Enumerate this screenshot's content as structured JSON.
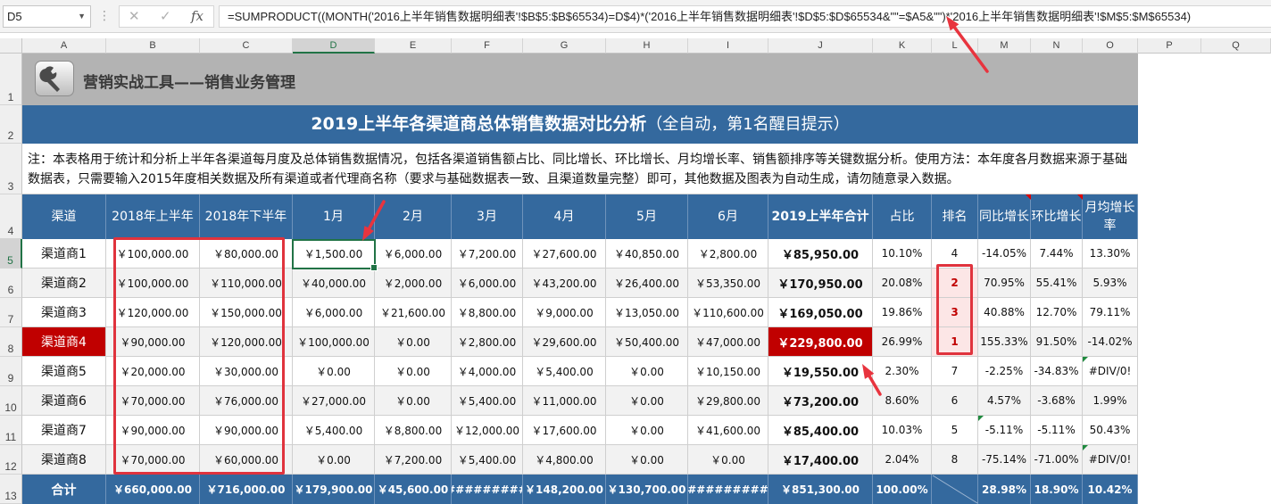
{
  "name_box": "D5",
  "formula": "=SUMPRODUCT((MONTH('2016上半年销售数据明细表'!$B$5:$B$65534)=D$4)*('2016上半年销售数据明细表'!$D$5:$D$65534&\"\"=$A5&\"\")*'2016上半年销售数据明细表'!$M$5:$M$65534)",
  "columns": [
    "A",
    "B",
    "C",
    "D",
    "E",
    "F",
    "G",
    "H",
    "I",
    "J",
    "K",
    "L",
    "M",
    "N",
    "O",
    "P",
    "Q"
  ],
  "rows": [
    "1",
    "2",
    "3",
    "4",
    "5",
    "6",
    "7",
    "8",
    "9",
    "10",
    "11",
    "12",
    "13"
  ],
  "app_title": "营销实战工具——销售业务管理",
  "sheet_title": "2019上半年各渠道商总体销售数据对比分析",
  "sheet_subtitle": "（全自动，第1名醒目提示）",
  "note": "注：本表格用于统计和分析上半年各渠道每月度及总体销售数据情况，包括各渠道销售额占比、同比增长、环比增长、月均增长率、销售额排序等关键数据分析。使用方法：本年度各月数据来源于基础数据表，只需要输入2015年度相关数据及所有渠道或者代理商名称（要求与基础数据表一致、且渠道数量完整）即可，其他数据及图表为自动生成，请勿随意录入数据。",
  "headers": [
    "渠道",
    "2018年上半年",
    "2018年下半年",
    "1月",
    "2月",
    "3月",
    "4月",
    "5月",
    "6月",
    "2019上半年合计",
    "占比",
    "排名",
    "同比增长",
    "环比增长",
    "月均增长率"
  ],
  "data_rows": [
    {
      "cells": [
        "渠道商1",
        "￥100,000.00",
        "￥80,000.00",
        "￥1,500.00",
        "￥6,000.00",
        "￥7,200.00",
        "￥27,600.00",
        "￥40,850.00",
        "￥2,800.00",
        "￥85,950.00",
        "10.10%",
        "4",
        "-14.05%",
        "7.44%",
        "13.30%"
      ]
    },
    {
      "cells": [
        "渠道商2",
        "￥100,000.00",
        "￥110,000.00",
        "￥40,000.00",
        "￥2,000.00",
        "￥6,000.00",
        "￥43,200.00",
        "￥26,400.00",
        "￥53,350.00",
        "￥170,950.00",
        "20.08%",
        "2",
        "70.95%",
        "55.41%",
        "5.93%"
      ]
    },
    {
      "cells": [
        "渠道商3",
        "￥120,000.00",
        "￥150,000.00",
        "￥6,000.00",
        "￥21,600.00",
        "￥8,800.00",
        "￥9,000.00",
        "￥13,050.00",
        "￥110,600.00",
        "￥169,050.00",
        "19.86%",
        "3",
        "40.88%",
        "12.70%",
        "79.11%"
      ]
    },
    {
      "cells": [
        "渠道商4",
        "￥90,000.00",
        "￥120,000.00",
        "￥100,000.00",
        "￥0.00",
        "￥2,800.00",
        "￥29,600.00",
        "￥50,400.00",
        "￥47,000.00",
        "￥229,800.00",
        "26.99%",
        "1",
        "155.33%",
        "91.50%",
        "-14.02%"
      ]
    },
    {
      "cells": [
        "渠道商5",
        "￥20,000.00",
        "￥30,000.00",
        "￥0.00",
        "￥0.00",
        "￥4,000.00",
        "￥5,400.00",
        "￥0.00",
        "￥10,150.00",
        "￥19,550.00",
        "2.30%",
        "7",
        "-2.25%",
        "-34.83%",
        "#DIV/0!"
      ]
    },
    {
      "cells": [
        "渠道商6",
        "￥70,000.00",
        "￥76,000.00",
        "￥27,000.00",
        "￥0.00",
        "￥5,400.00",
        "￥11,000.00",
        "￥0.00",
        "￥29,800.00",
        "￥73,200.00",
        "8.60%",
        "6",
        "4.57%",
        "-3.68%",
        "1.99%"
      ]
    },
    {
      "cells": [
        "渠道商7",
        "￥90,000.00",
        "￥90,000.00",
        "￥5,400.00",
        "￥8,800.00",
        "￥12,000.00",
        "￥17,600.00",
        "￥0.00",
        "￥41,600.00",
        "￥85,400.00",
        "10.03%",
        "5",
        "-5.11%",
        "-5.11%",
        "50.43%"
      ]
    },
    {
      "cells": [
        "渠道商8",
        "￥70,000.00",
        "￥60,000.00",
        "￥0.00",
        "￥7,200.00",
        "￥5,400.00",
        "￥4,800.00",
        "￥0.00",
        "￥0.00",
        "￥17,400.00",
        "2.04%",
        "8",
        "-75.14%",
        "-71.00%",
        "#DIV/0!"
      ]
    }
  ],
  "total_row": [
    "合计",
    "￥660,000.00",
    "￥716,000.00",
    "￥179,900.00",
    "￥45,600.00",
    "#########",
    "￥148,200.00",
    "￥130,700.00",
    "#########",
    "￥851,300.00",
    "100.00%",
    "",
    "28.98%",
    "18.90%",
    "10.42%"
  ],
  "highlight_row_index": 3,
  "colors": {
    "header_blue": "#34699e",
    "highlight_red": "#c00000",
    "annotation_red": "#e0333d",
    "gray_band": "#b3b3b3",
    "excel_green": "#217346"
  }
}
